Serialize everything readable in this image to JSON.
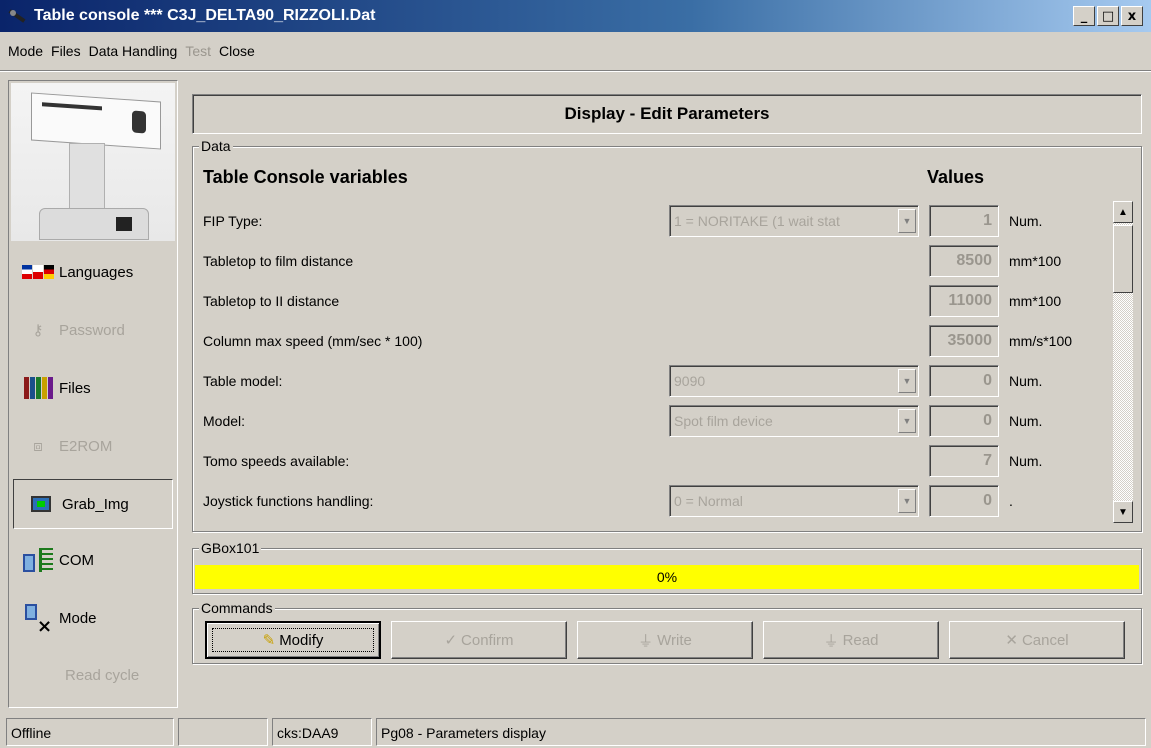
{
  "window": {
    "title": "Table console *** C3J_DELTA90_RIZZOLI.Dat",
    "minimize": "_",
    "maximize": "□",
    "close": "x"
  },
  "menu": [
    "Mode",
    "Files",
    "Data Handling",
    "Test",
    "Close"
  ],
  "sidebar": {
    "languages": "Languages",
    "password": "Password",
    "files": "Files",
    "e2rom": "E2ROM",
    "grab_img": "Grab_Img",
    "com": "COM",
    "mode": "Mode",
    "read_cycle": "Read cycle"
  },
  "header": {
    "title": "Display - Edit Parameters"
  },
  "data_group": {
    "label": "Data",
    "col_variables": "Table Console variables",
    "col_values": "Values",
    "rows": [
      {
        "label": "FIP Type:",
        "combo": "1 = NORITAKE (1 wait stat",
        "value": "1",
        "unit": "Num."
      },
      {
        "label": "Tabletop to film distance",
        "combo": null,
        "value": "8500",
        "unit": "mm*100"
      },
      {
        "label": "Tabletop to II distance",
        "combo": null,
        "value": "11000",
        "unit": "mm*100"
      },
      {
        "label": "Column max speed (mm/sec * 100)",
        "combo": null,
        "value": "35000",
        "unit": "mm/s*100"
      },
      {
        "label": "Table model:",
        "combo": "9090",
        "value": "0",
        "unit": "Num."
      },
      {
        "label": "Model:",
        "combo": "Spot film device",
        "value": "0",
        "unit": "Num."
      },
      {
        "label": "Tomo speeds available:",
        "combo": null,
        "value": "7",
        "unit": "Num."
      },
      {
        "label": "Joystick functions handling:",
        "combo": "0 = Normal",
        "value": "0",
        "unit": "."
      }
    ]
  },
  "gbox": {
    "label": "GBox101",
    "progress_text": "0%",
    "progress": 0
  },
  "commands": {
    "label": "Commands",
    "modify": "Modify",
    "confirm": "Confirm",
    "write": "Write",
    "read": "Read",
    "cancel": "Cancel"
  },
  "status": {
    "state": "Offline",
    "empty": "",
    "checksum": "cks:DAA9",
    "page": "Pg08 - Parameters display"
  },
  "colors": {
    "title_bar": "#0a246a",
    "progress": "#ffff00",
    "face": "#d4d0c8"
  }
}
